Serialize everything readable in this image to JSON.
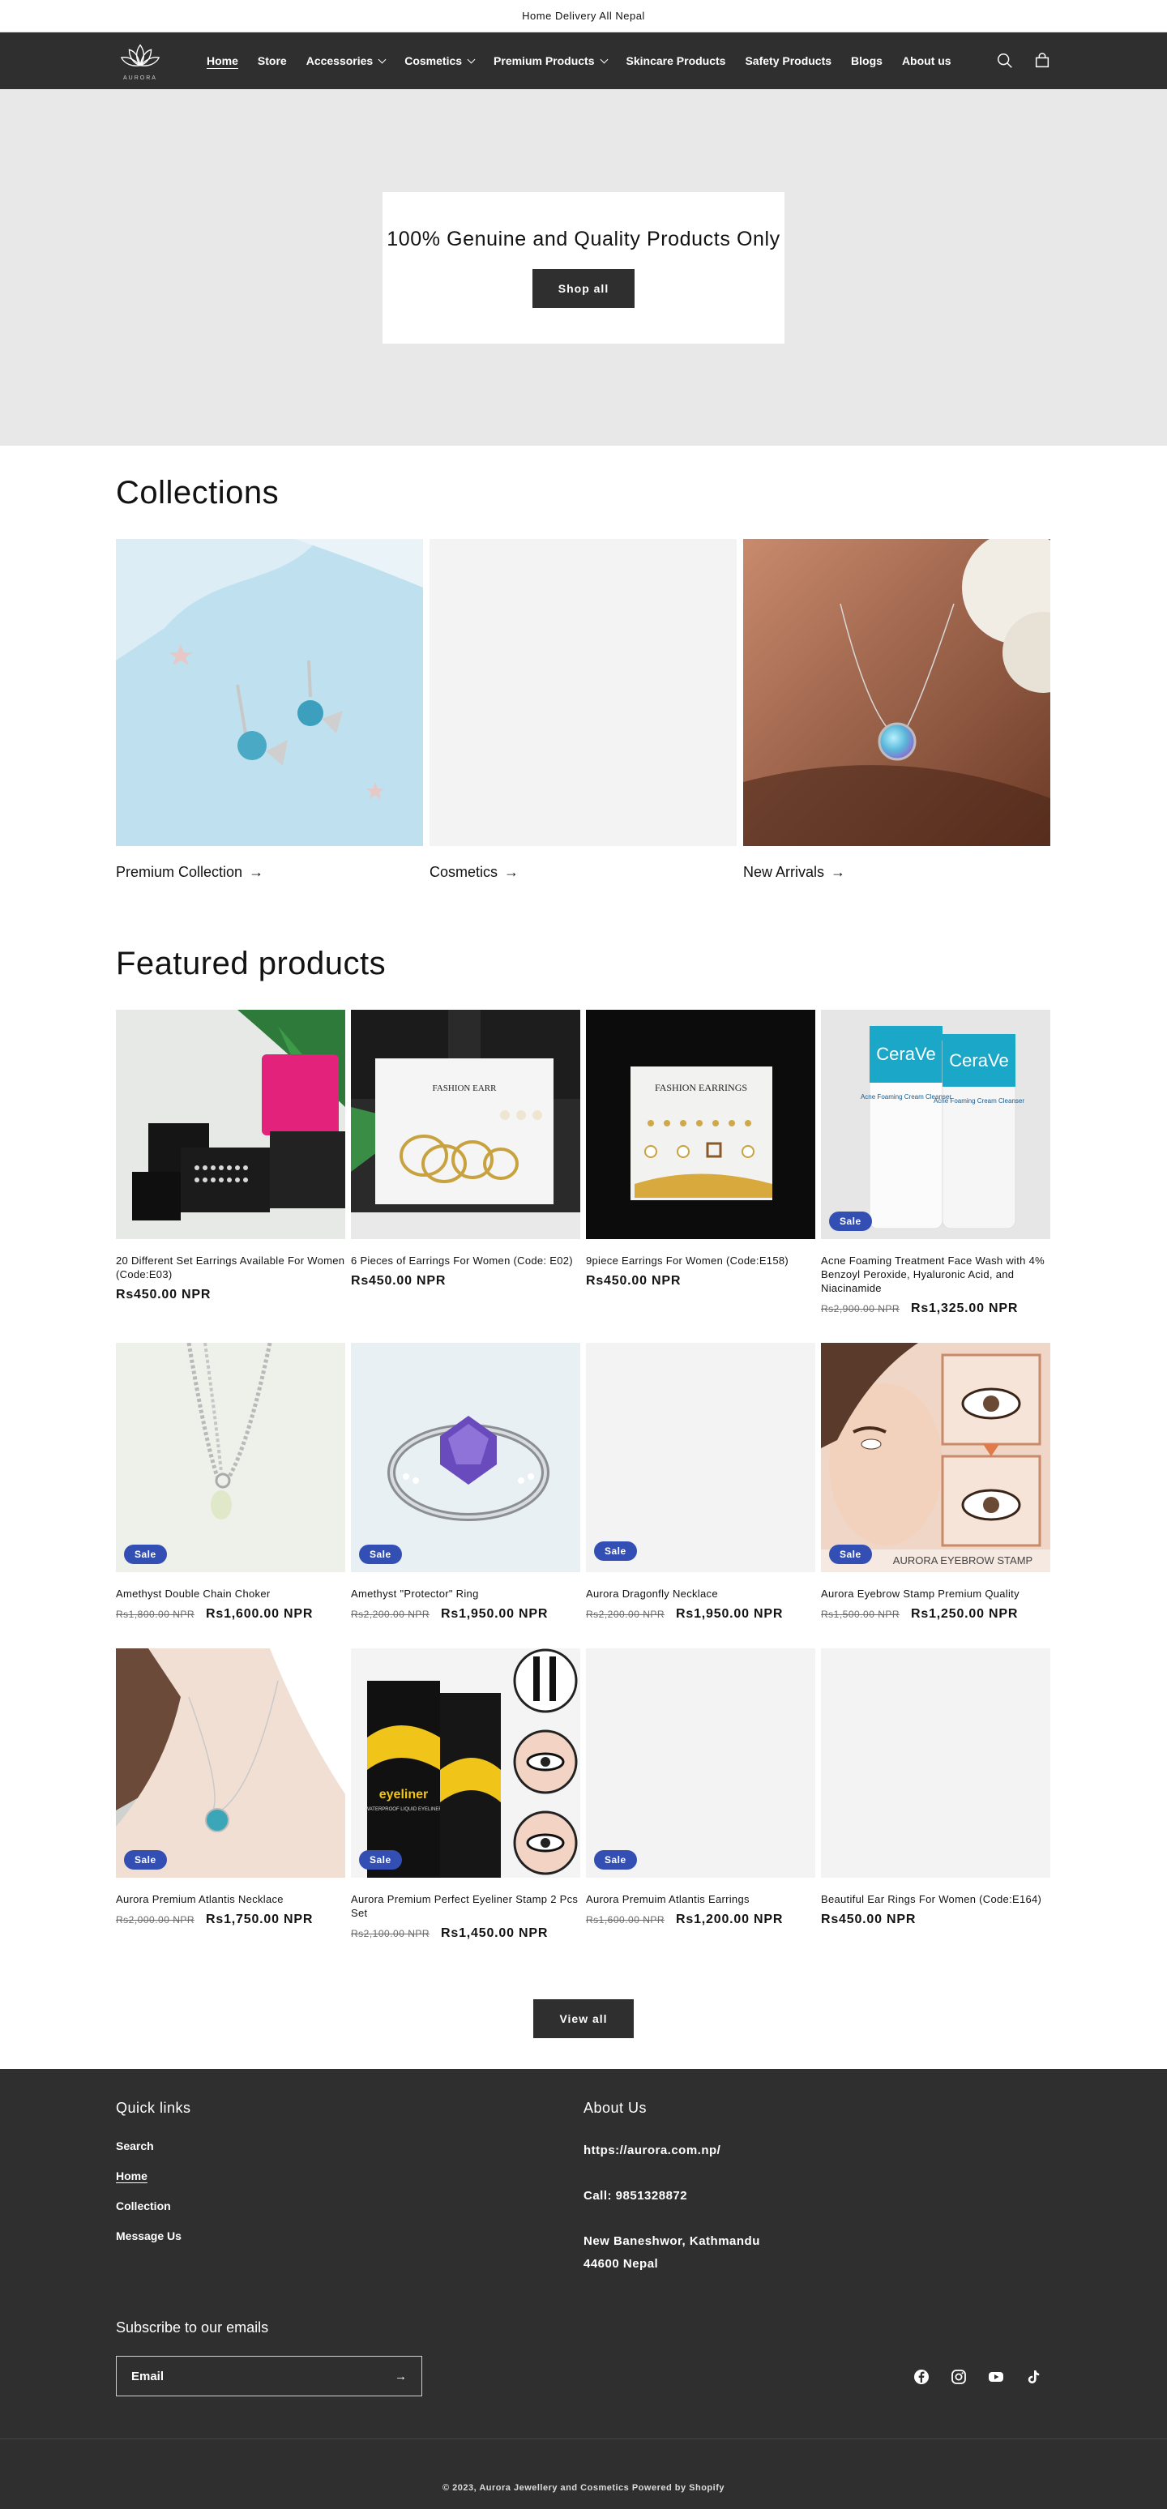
{
  "announcement": "Home Delivery All Nepal",
  "logo_text": "AURORA",
  "nav": [
    {
      "label": "Home",
      "active": true,
      "dropdown": false
    },
    {
      "label": "Store",
      "dropdown": false
    },
    {
      "label": "Accessories",
      "dropdown": true
    },
    {
      "label": "Cosmetics",
      "dropdown": true
    },
    {
      "label": "Premium Products",
      "dropdown": true
    },
    {
      "label": "Skincare Products",
      "dropdown": false
    },
    {
      "label": "Safety Products",
      "dropdown": false
    },
    {
      "label": "Blogs",
      "dropdown": false
    },
    {
      "label": "About us",
      "dropdown": false
    }
  ],
  "hero": {
    "title": "100% Genuine and Quality Products Only",
    "button": "Shop all"
  },
  "collections": {
    "title": "Collections",
    "items": [
      {
        "label": "Premium Collection"
      },
      {
        "label": "Cosmetics"
      },
      {
        "label": "New Arrivals"
      }
    ]
  },
  "featured": {
    "title": "Featured products",
    "badge": "Sale",
    "products": [
      {
        "name": "20 Different Set Earrings Available For Women (Code:E03)",
        "old_price": "",
        "price": "Rs450.00 NPR",
        "sale": false
      },
      {
        "name": "6 Pieces of Earrings For Women (Code: E02)",
        "old_price": "",
        "price": "Rs450.00 NPR",
        "sale": false
      },
      {
        "name": "9piece Earrings For Women (Code:E158)",
        "old_price": "",
        "price": "Rs450.00 NPR",
        "sale": false
      },
      {
        "name": "Acne Foaming Treatment Face Wash with 4% Benzoyl Peroxide, Hyaluronic Acid, and Niacinamide",
        "old_price": "Rs2,900.00 NPR",
        "price": "Rs1,325.00 NPR",
        "sale": true
      },
      {
        "name": "Amethyst Double Chain Choker",
        "old_price": "Rs1,800.00 NPR",
        "price": "Rs1,600.00 NPR",
        "sale": true
      },
      {
        "name": "Amethyst \"Protector\" Ring",
        "old_price": "Rs2,200.00 NPR",
        "price": "Rs1,950.00 NPR",
        "sale": true
      },
      {
        "name": "Aurora Dragonfly Necklace",
        "old_price": "Rs2,200.00 NPR",
        "price": "Rs1,950.00 NPR",
        "sale": true
      },
      {
        "name": "Aurora Eyebrow Stamp Premium Quality",
        "old_price": "Rs1,500.00 NPR",
        "price": "Rs1,250.00 NPR",
        "sale": true
      },
      {
        "name": "Aurora Premium Atlantis Necklace",
        "old_price": "Rs2,000.00 NPR",
        "price": "Rs1,750.00 NPR",
        "sale": true
      },
      {
        "name": "Aurora Premium Perfect Eyeliner Stamp 2 Pcs Set",
        "old_price": "Rs2,100.00 NPR",
        "price": "Rs1,450.00 NPR",
        "sale": true
      },
      {
        "name": "Aurora Premuim Atlantis Earrings",
        "old_price": "Rs1,600.00 NPR",
        "price": "Rs1,200.00 NPR",
        "sale": true
      },
      {
        "name": "Beautiful Ear Rings For Women (Code:E164)",
        "old_price": "",
        "price": "Rs450.00 NPR",
        "sale": false
      }
    ],
    "view_all": "View all"
  },
  "image_text": {
    "fashion_earrings_1": "FASHION EARR",
    "fashion_earrings_2": "FASHION EARRINGS",
    "cerave_brand": "CeraVe",
    "cerave_product": "Acne Foaming Cream Cleanser",
    "eyebrow_banner": "AURORA EYEBROW STAMP",
    "eyeliner_box": "eyeliner",
    "eyeliner_sub": "WATERPROOF LIQUID EYELINER"
  },
  "footer": {
    "quick_links_title": "Quick links",
    "links": [
      "Search",
      "Home",
      "Collection",
      "Message Us"
    ],
    "about_title": "About Us",
    "website": "https://aurora.com.np/",
    "phone": "Call: 9851328872",
    "address_1": "New Baneshwor, Kathmandu",
    "address_2": "44600 Nepal",
    "subscribe_title": "Subscribe to our emails",
    "email_placeholder": "Email",
    "copyright": "© 2023, Aurora Jewellery and Cosmetics Powered by Shopify"
  }
}
